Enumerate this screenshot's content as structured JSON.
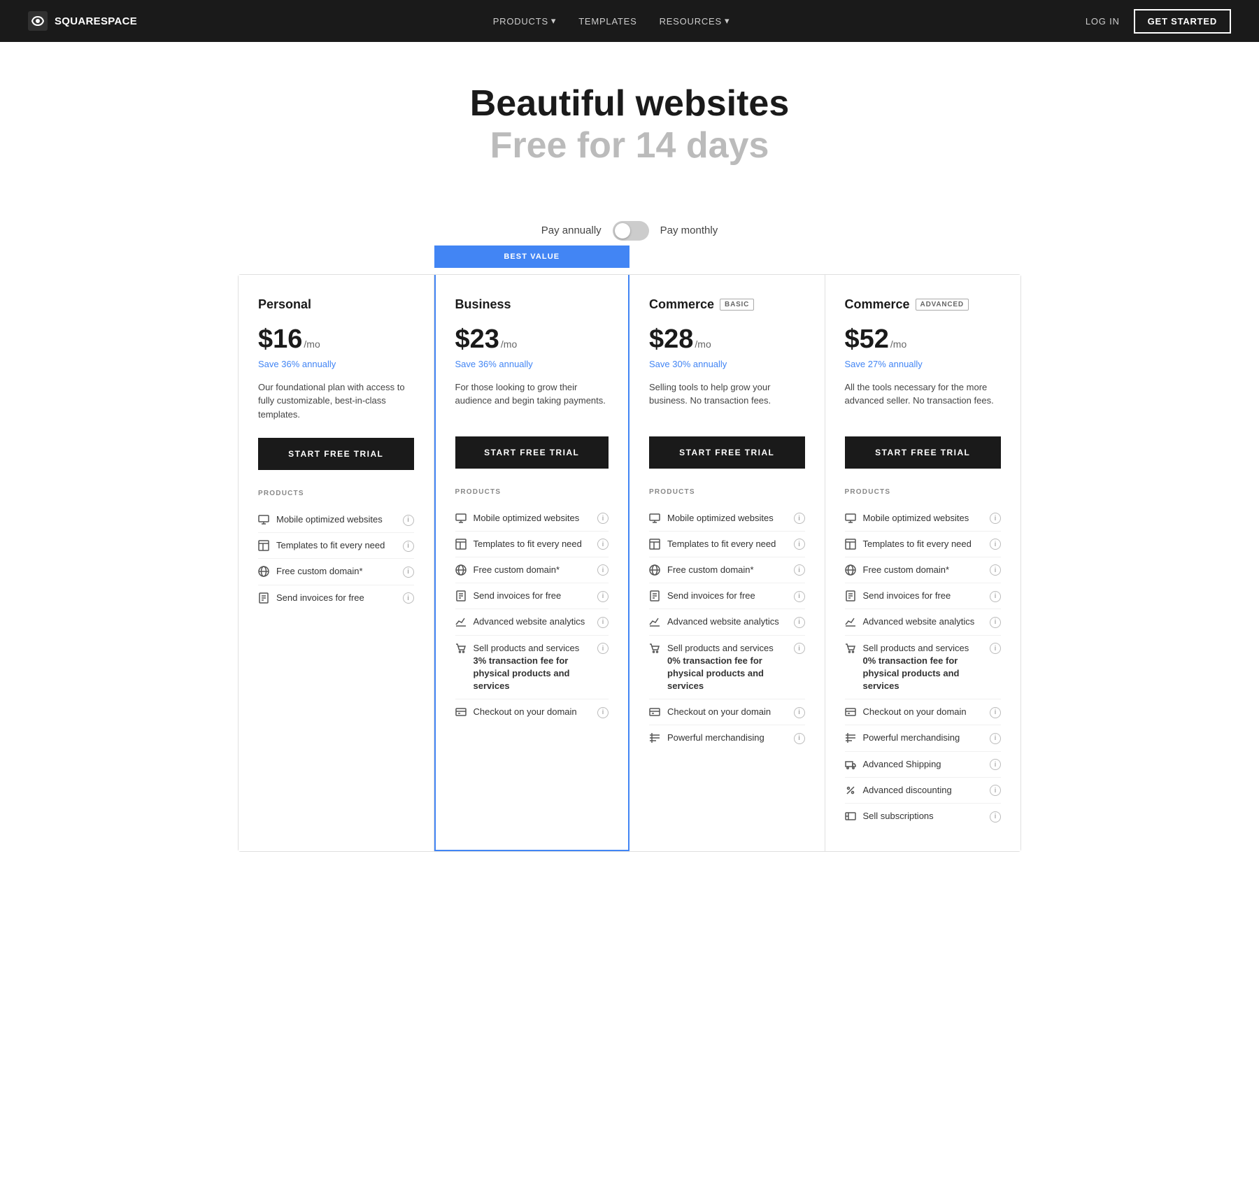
{
  "nav": {
    "logo_text": "SQUARESPACE",
    "links": [
      {
        "label": "PRODUCTS",
        "has_dropdown": true
      },
      {
        "label": "TEMPLATES",
        "has_dropdown": false
      },
      {
        "label": "RESOURCES",
        "has_dropdown": true
      }
    ],
    "login_label": "LOG IN",
    "get_started_label": "GET STARTED"
  },
  "hero": {
    "title": "Beautiful websites",
    "subtitle": "Free for 14 days"
  },
  "billing": {
    "annually_label": "Pay annually",
    "monthly_label": "Pay monthly",
    "toggle_state": false
  },
  "best_value_label": "BEST VALUE",
  "plans": [
    {
      "name": "Personal",
      "badge": null,
      "price": "$16",
      "period": "/mo",
      "savings": "Save 36% annually",
      "description": "Our foundational plan with access to fully customizable, best-in-class templates.",
      "cta": "START FREE TRIAL",
      "highlighted": false,
      "features_label": "PRODUCTS",
      "features": [
        {
          "icon": "monitor-icon",
          "text": "Mobile optimized websites",
          "sub": null
        },
        {
          "icon": "template-icon",
          "text": "Templates to fit every need",
          "sub": null
        },
        {
          "icon": "globe-icon",
          "text": "Free custom domain*",
          "sub": null
        },
        {
          "icon": "invoice-icon",
          "text": "Send invoices for free",
          "sub": null
        }
      ]
    },
    {
      "name": "Business",
      "badge": null,
      "price": "$23",
      "period": "/mo",
      "savings": "Save 36% annually",
      "description": "For those looking to grow their audience and begin taking payments.",
      "cta": "START FREE TRIAL",
      "highlighted": true,
      "features_label": "PRODUCTS",
      "features": [
        {
          "icon": "monitor-icon",
          "text": "Mobile optimized websites",
          "sub": null
        },
        {
          "icon": "template-icon",
          "text": "Templates to fit every need",
          "sub": null
        },
        {
          "icon": "globe-icon",
          "text": "Free custom domain*",
          "sub": null
        },
        {
          "icon": "invoice-icon",
          "text": "Send invoices for free",
          "sub": null
        },
        {
          "icon": "analytics-icon",
          "text": "Advanced website analytics",
          "sub": null
        },
        {
          "icon": "cart-icon",
          "text": "Sell products and services",
          "sub": "3% transaction fee for physical products and services"
        },
        {
          "icon": "card-icon",
          "text": "Checkout on your domain",
          "sub": null
        }
      ]
    },
    {
      "name": "Commerce",
      "badge": "BASIC",
      "price": "$28",
      "period": "/mo",
      "savings": "Save 30% annually",
      "description": "Selling tools to help grow your business. No transaction fees.",
      "cta": "START FREE TRIAL",
      "highlighted": false,
      "features_label": "PRODUCTS",
      "features": [
        {
          "icon": "monitor-icon",
          "text": "Mobile optimized websites",
          "sub": null
        },
        {
          "icon": "template-icon",
          "text": "Templates to fit every need",
          "sub": null
        },
        {
          "icon": "globe-icon",
          "text": "Free custom domain*",
          "sub": null
        },
        {
          "icon": "invoice-icon",
          "text": "Send invoices for free",
          "sub": null
        },
        {
          "icon": "analytics-icon",
          "text": "Advanced website analytics",
          "sub": null
        },
        {
          "icon": "cart-icon",
          "text": "Sell products and services",
          "sub": "0% transaction fee for physical products and services"
        },
        {
          "icon": "card-icon",
          "text": "Checkout on your domain",
          "sub": null
        },
        {
          "icon": "merchandise-icon",
          "text": "Powerful merchandising",
          "sub": null
        }
      ]
    },
    {
      "name": "Commerce",
      "badge": "ADVANCED",
      "price": "$52",
      "period": "/mo",
      "savings": "Save 27% annually",
      "description": "All the tools necessary for the more advanced seller. No transaction fees.",
      "cta": "START FREE TRIAL",
      "highlighted": false,
      "features_label": "PRODUCTS",
      "features": [
        {
          "icon": "monitor-icon",
          "text": "Mobile optimized websites",
          "sub": null
        },
        {
          "icon": "template-icon",
          "text": "Templates to fit every need",
          "sub": null
        },
        {
          "icon": "globe-icon",
          "text": "Free custom domain*",
          "sub": null
        },
        {
          "icon": "invoice-icon",
          "text": "Send invoices for free",
          "sub": null
        },
        {
          "icon": "analytics-icon",
          "text": "Advanced website analytics",
          "sub": null
        },
        {
          "icon": "cart-icon",
          "text": "Sell products and services",
          "sub": "0% transaction fee for physical products and services"
        },
        {
          "icon": "card-icon",
          "text": "Checkout on your domain",
          "sub": null
        },
        {
          "icon": "merchandise-icon",
          "text": "Powerful merchandising",
          "sub": null
        },
        {
          "icon": "shipping-icon",
          "text": "Advanced Shipping",
          "sub": null
        },
        {
          "icon": "discount-icon",
          "text": "Advanced discounting",
          "sub": null
        },
        {
          "icon": "subscription-icon",
          "text": "Sell subscriptions",
          "sub": null
        }
      ]
    }
  ]
}
